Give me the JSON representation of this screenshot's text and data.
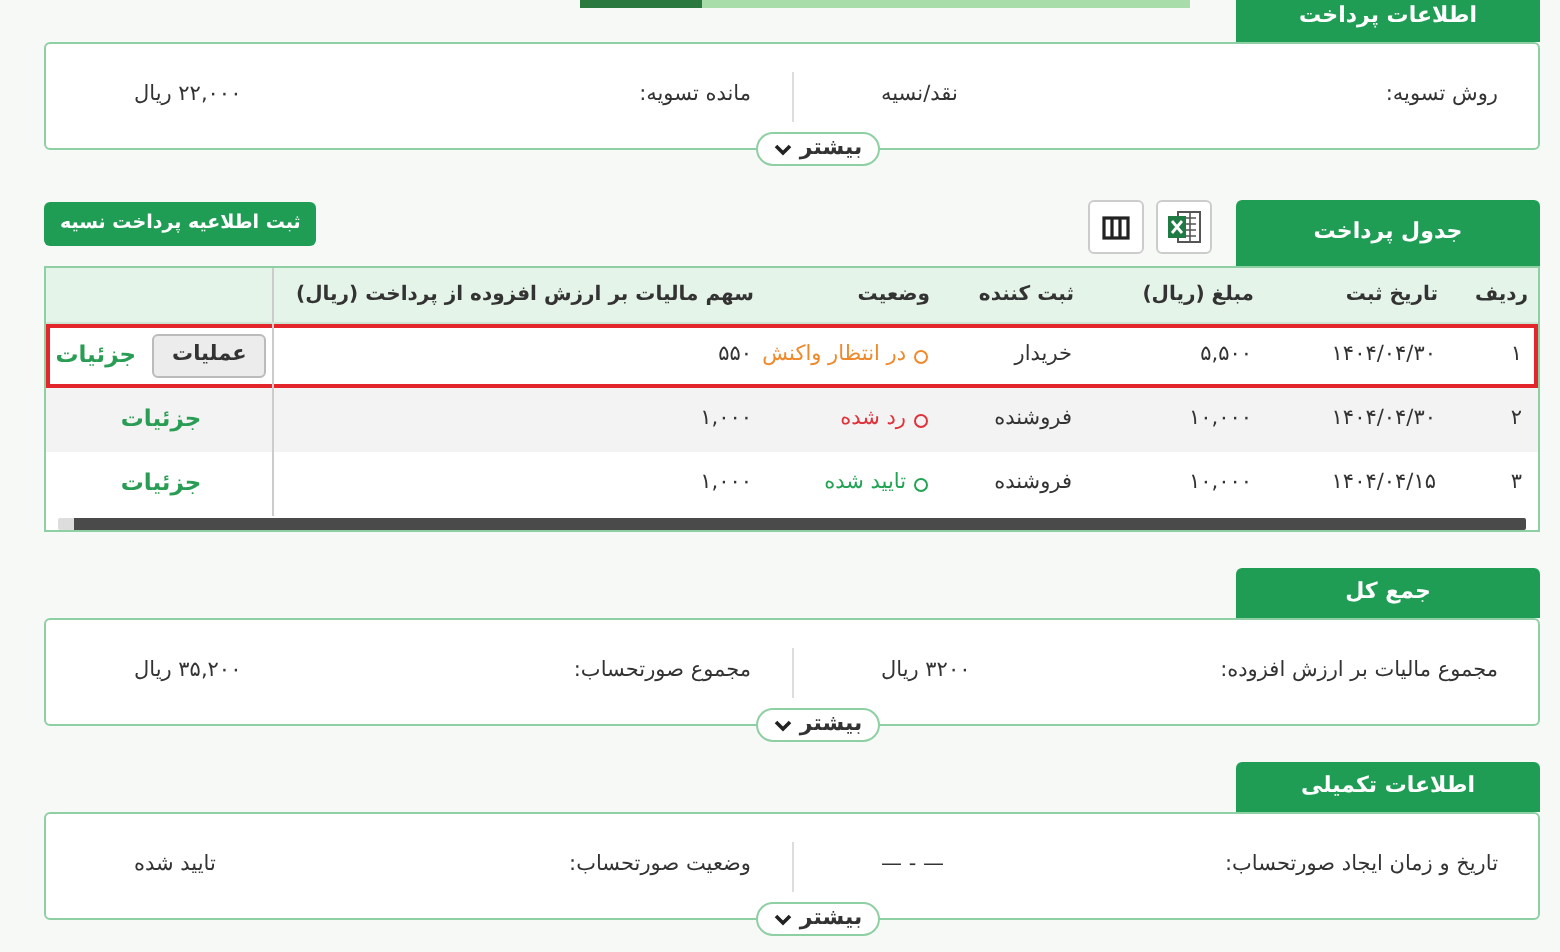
{
  "progress": {
    "level": 0.2
  },
  "sections": [
    {
      "kind": "info",
      "title": "اطلاعات پرداخت",
      "fields": [
        {
          "label": "روش تسویه:",
          "value": "نقد/نسیه"
        },
        {
          "label": "مانده تسویه:",
          "value": "۲۲,۰۰۰ ریال"
        }
      ],
      "more": "بیشتر"
    },
    {
      "kind": "table",
      "title": "جدول پرداخت",
      "action_button": "ثبت اطلاعیه پرداخت نسیه",
      "columns": [
        "ردیف",
        "تاریخ ثبت",
        "مبلغ (ریال)",
        "ثبت کننده",
        "وضعیت",
        "سهم مالیات بر ارزش افزوده از پرداخت (ریال)"
      ],
      "rows": [
        {
          "cells": [
            "۱",
            "۱۴۰۴/۰۴/۳۰",
            "۵,۵۰۰",
            "خریدار"
          ],
          "status": {
            "text": "در انتظار واکنش",
            "color": "#f0892b"
          },
          "vat": "۵۵۰",
          "operations": "عملیات",
          "details": "جزئیات",
          "selected": true
        },
        {
          "cells": [
            "۲",
            "۱۴۰۴/۰۴/۳۰",
            "۱۰,۰۰۰",
            "فروشنده"
          ],
          "status": {
            "text": "رد شده",
            "color": "#e0323a"
          },
          "vat": "۱,۰۰۰",
          "details": "جزئیات",
          "selected": false
        },
        {
          "cells": [
            "۳",
            "۱۴۰۴/۰۴/۱۵",
            "۱۰,۰۰۰",
            "فروشنده"
          ],
          "status": {
            "text": "تایید شده",
            "color": "#23a455"
          },
          "vat": "۱,۰۰۰",
          "details": "جزئیات",
          "selected": false
        }
      ]
    },
    {
      "kind": "info",
      "title": "جمع کل",
      "fields": [
        {
          "label": "مجموع مالیات بر ارزش افزوده:",
          "value": "۳۲۰۰ ریال"
        },
        {
          "label": "مجموع صورتحساب:",
          "value": "۳۵,۲۰۰ ریال"
        }
      ],
      "more": "بیشتر"
    },
    {
      "kind": "info",
      "title": "اطلاعات تکمیلی",
      "fields": [
        {
          "label": "تاریخ و زمان ایجاد صورتحساب:",
          "value": "— - —"
        },
        {
          "label": "وضعیت صورتحساب:",
          "value": "تایید شده"
        }
      ],
      "more": "بیشتر"
    }
  ]
}
